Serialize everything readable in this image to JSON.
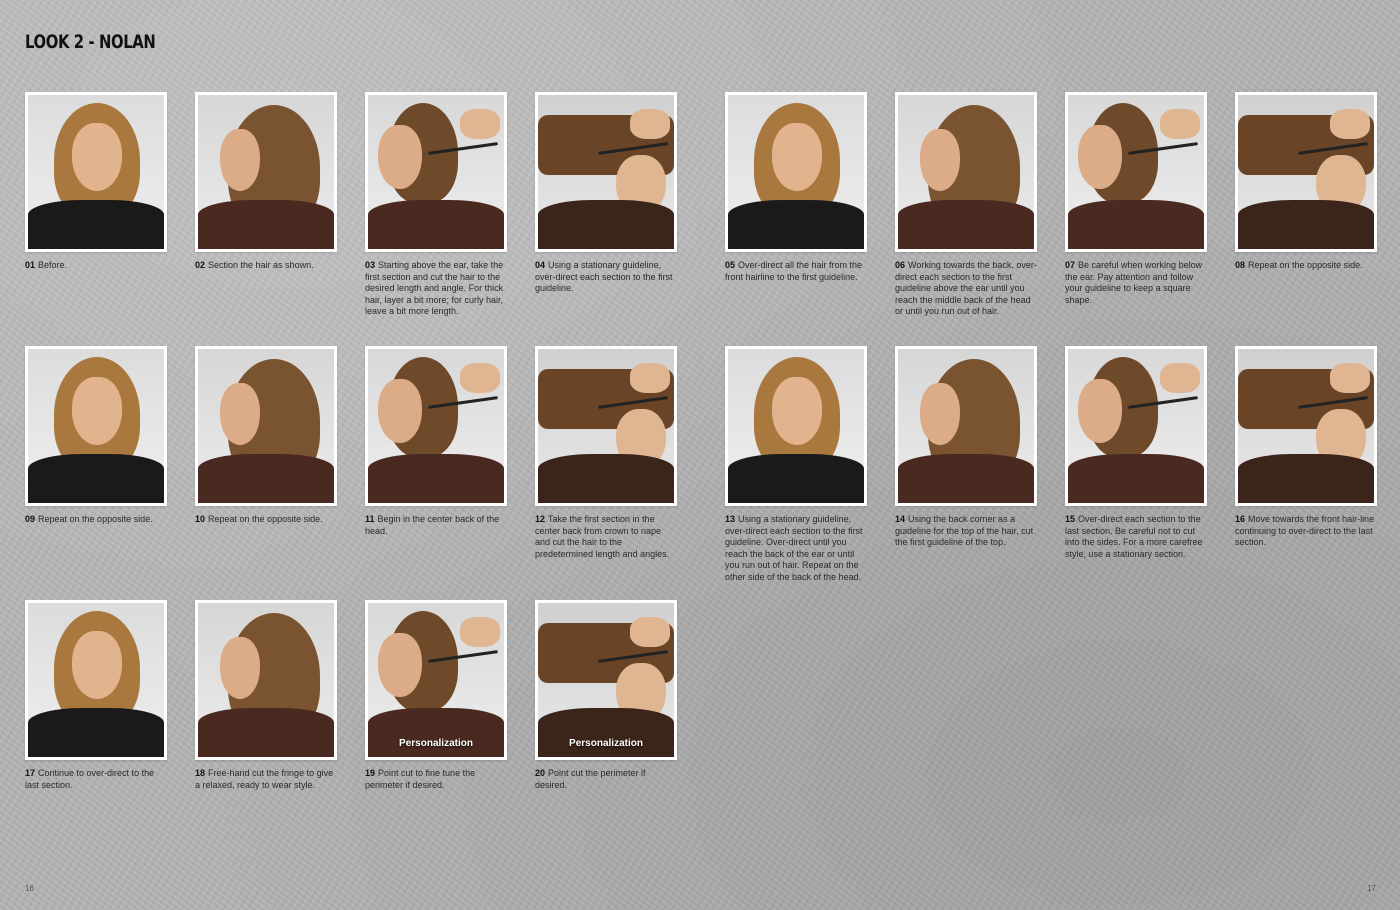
{
  "title": "LOOK 2 - NOLAN",
  "page_left": "16",
  "page_right": "17",
  "steps": [
    {
      "num": "01",
      "text": "Before."
    },
    {
      "num": "02",
      "text": "Section the hair as shown."
    },
    {
      "num": "03",
      "text": "Starting above the ear, take the first section and cut the hair to the desired length and angle. For thick hair, layer a bit more; for curly hair, leave a bit more length."
    },
    {
      "num": "04",
      "text": "Using a stationary guideline, over-direct each section to the first guideline."
    },
    {
      "num": "05",
      "text": "Over-direct all the hair from the front hairline to the first guideline."
    },
    {
      "num": "06",
      "text": "Working towards the back, over-direct each section to the first guideline above the ear until you reach the middle back of the head or until you run out of hair."
    },
    {
      "num": "07",
      "text": "Be careful when working below the ear.  Pay attention and follow your guideline to keep a square shape."
    },
    {
      "num": "08",
      "text": "Repeat on the opposite side."
    },
    {
      "num": "09",
      "text": "Repeat on the opposite side."
    },
    {
      "num": "10",
      "text": "Repeat on the opposite side."
    },
    {
      "num": "11",
      "text": "Begin in the center back of the head."
    },
    {
      "num": "12",
      "text": "Take the first section in the center back from crown to nape and cut the hair to the predetermined length and angles."
    },
    {
      "num": "13",
      "text": "Using a stationary guideline, over-direct each section to the first guideline. Over-direct until you reach the back of the ear or until you run out of hair.  Repeat on the other side of the back of the head."
    },
    {
      "num": "14",
      "text": "Using the back corner as a guideline for the top of the hair, cut the first guideline of the top."
    },
    {
      "num": "15",
      "text": "Over-direct each section to the last section.  Be careful not to cut into the sides.  For a more carefree style, use a stationary section."
    },
    {
      "num": "16",
      "text": "Move towards the front hair-line continuing to over-direct to the last section."
    },
    {
      "num": "17",
      "text": "Continue to over-direct to the last section."
    },
    {
      "num": "18",
      "text": "Free-hand cut the fringe to give a relaxed, ready to wear style."
    },
    {
      "num": "19",
      "text": "Point cut to fine tune the perimeter if desired.",
      "badge": "Personalization"
    },
    {
      "num": "20",
      "text": "Point cut the perimeter if desired.",
      "badge": "Personalization"
    }
  ]
}
